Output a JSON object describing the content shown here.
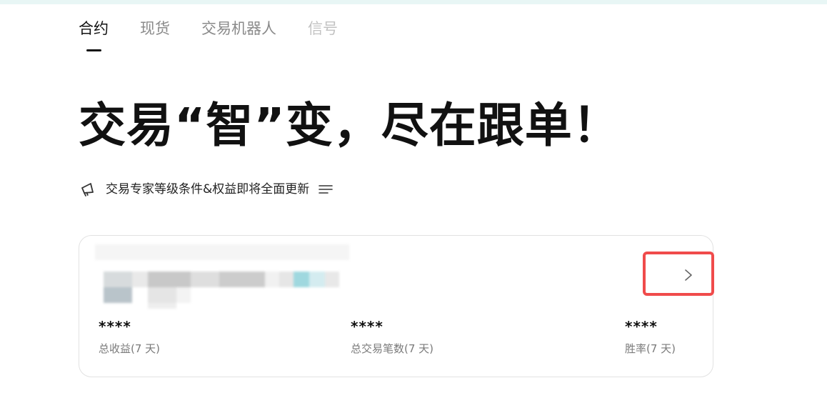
{
  "tabs": [
    {
      "label": "合约",
      "state": "active"
    },
    {
      "label": "现货",
      "state": "normal"
    },
    {
      "label": "交易机器人",
      "state": "normal"
    },
    {
      "label": "信号",
      "state": "dim"
    }
  ],
  "hero": {
    "title": "交易“智”变，尽在跟单！"
  },
  "announcement": {
    "icon": "megaphone-icon",
    "text": "交易专家等级条件&权益即将全面更新",
    "menu_icon": "list-icon"
  },
  "card": {
    "arrow_icon": "chevron-right-icon",
    "highlight_color": "#f04b4b",
    "stats": [
      {
        "value": "****",
        "label": "总收益(7 天)"
      },
      {
        "value": "****",
        "label": "总交易笔数(7 天)"
      },
      {
        "value": "****",
        "label": "胜率(7 天)"
      }
    ]
  },
  "colors": {
    "top_strip": "#e8f6f5",
    "text_primary": "#111111",
    "text_secondary": "#7a7a7a"
  }
}
